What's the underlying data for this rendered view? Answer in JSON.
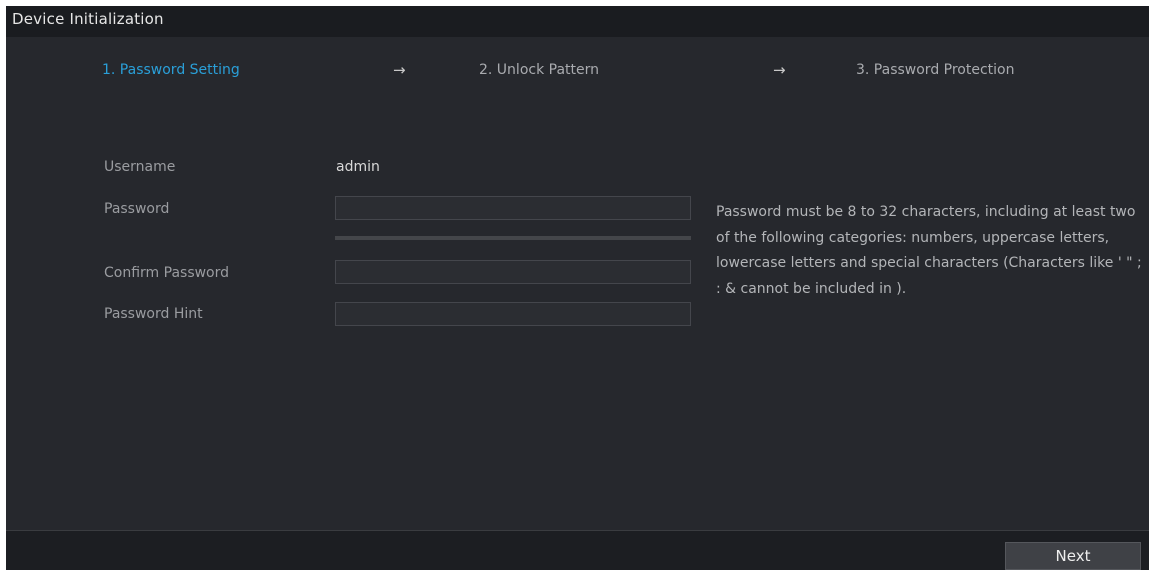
{
  "window": {
    "title": "Device Initialization"
  },
  "steps": [
    {
      "label": "1.  Password Setting",
      "active": true
    },
    {
      "label": "2.  Unlock Pattern",
      "active": false
    },
    {
      "label": "3.  Password Protection",
      "active": false
    }
  ],
  "step_arrow": "→",
  "form": {
    "username_label": "Username",
    "username_value": "admin",
    "password_label": "Password",
    "password_value": "",
    "confirm_label": "Confirm Password",
    "confirm_value": "",
    "hint_label": "Password Hint",
    "hint_value": ""
  },
  "password_rules": "Password must be 8 to 32 characters, including at least two of the following categories: numbers, uppercase letters, lowercase letters and special characters  (Characters like ' \" ; : & cannot be included in ).",
  "footer": {
    "next_label": "Next"
  },
  "colors": {
    "background": "#26282d",
    "titlebar": "#1a1c20",
    "active_step": "#2a9fd8",
    "text": "#9a9ca0"
  }
}
